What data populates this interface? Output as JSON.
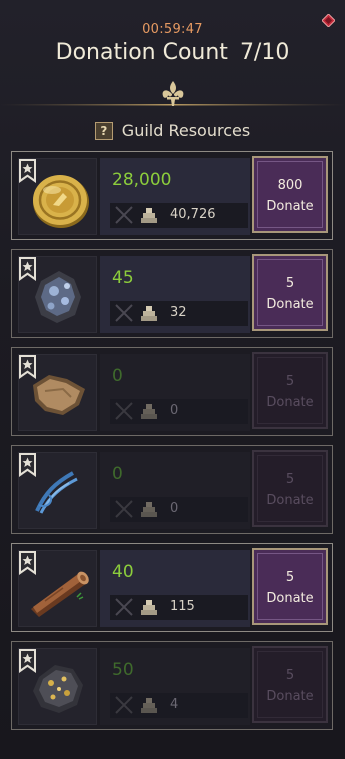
{
  "header": {
    "timer": "00:59:47",
    "title": "Donation Count",
    "count": "7/10"
  },
  "section": {
    "label": "Guild Resources"
  },
  "colors": {
    "amount_active": "#8ccd3c",
    "amount_inactive": "#3f6a2c",
    "button_active": "#4a2c57",
    "button_inactive": "#241d29",
    "timer": "#e79a62"
  },
  "resources": [
    {
      "icon": "gold-coin-icon",
      "amount": "28,000",
      "stock": "40,726",
      "cost": "800",
      "donate_label": "Donate",
      "enabled": true
    },
    {
      "icon": "ore-icon",
      "amount": "45",
      "stock": "32",
      "cost": "5",
      "donate_label": "Donate",
      "enabled": true
    },
    {
      "icon": "leather-hide-icon",
      "amount": "0",
      "stock": "0",
      "cost": "5",
      "donate_label": "Donate",
      "enabled": false
    },
    {
      "icon": "blue-thread-icon",
      "amount": "0",
      "stock": "0",
      "cost": "5",
      "donate_label": "Donate",
      "enabled": false
    },
    {
      "icon": "wood-log-icon",
      "amount": "40",
      "stock": "115",
      "cost": "5",
      "donate_label": "Donate",
      "enabled": true
    },
    {
      "icon": "gold-ore-icon",
      "amount": "50",
      "stock": "4",
      "cost": "5",
      "donate_label": "Donate",
      "enabled": false
    }
  ]
}
